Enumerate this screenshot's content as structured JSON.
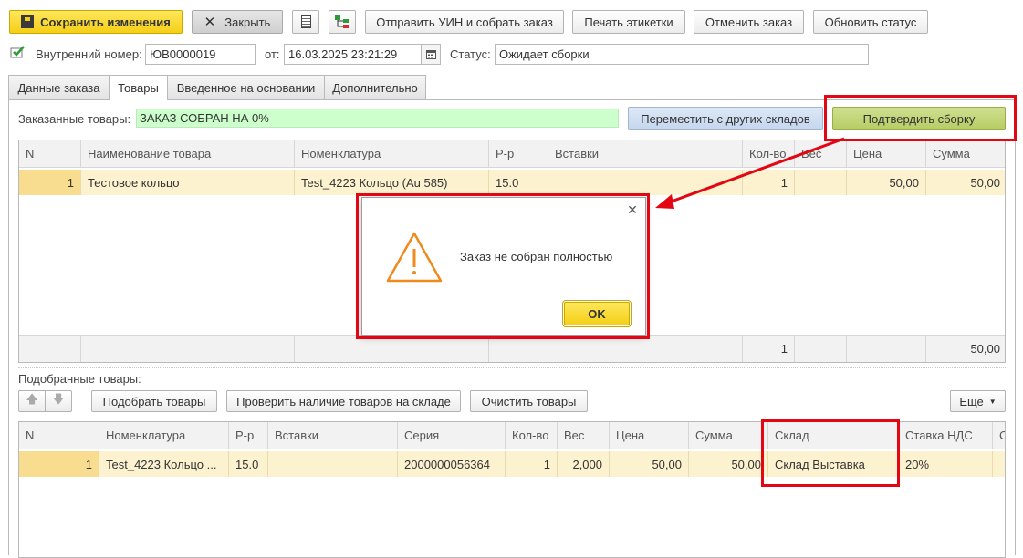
{
  "toolbar": {
    "save_label": "Сохранить изменения",
    "close_label": "Закрыть",
    "send_uin_label": "Отправить УИН и собрать заказ",
    "print_labels_label": "Печать этикетки",
    "cancel_order_label": "Отменить заказ",
    "refresh_status_label": "Обновить статус"
  },
  "header": {
    "internal_number_label": "Внутренний номер:",
    "internal_number_value": "ЮВ0000019",
    "from_label": "от:",
    "date_value": "16.03.2025 23:21:29",
    "status_label": "Статус:",
    "status_value": "Ожидает сборки"
  },
  "tabs": [
    {
      "label": "Данные заказа",
      "active": false
    },
    {
      "label": "Товары",
      "active": true
    },
    {
      "label": "Введенное на основании",
      "active": false
    },
    {
      "label": "Дополнительно",
      "active": false
    }
  ],
  "ordered": {
    "label": "Заказанные товары:",
    "progress_text": "ЗАКАЗ СОБРАН НА 0%",
    "move_button": "Переместить с других складов",
    "confirm_button": "Подтвердить сборку",
    "columns": [
      "N",
      "Наименование товара",
      "Номенклатура",
      "Р-р",
      "Вставки",
      "Кол-во",
      "Вес",
      "Цена",
      "Сумма"
    ],
    "row": {
      "n": "1",
      "name": "Тестовое кольцо",
      "nomenclature": "Test_4223 Кольцо (Au 585)",
      "size": "15.0",
      "inserts": "",
      "qty": "1",
      "weight": "",
      "price": "50,00",
      "sum": "50,00"
    },
    "footer": {
      "qty": "1",
      "sum": "50,00"
    }
  },
  "dialog": {
    "message": "Заказ не собран полностью",
    "ok_label": "OK",
    "icon": "warning-icon"
  },
  "picked": {
    "label": "Подобранные товары:",
    "pick_button": "Подобрать товары",
    "check_button": "Проверить наличие товаров на складе",
    "clear_button": "Очистить товары",
    "more_button": "Еще",
    "columns": [
      "N",
      "Номенклатура",
      "Р-р",
      "Вставки",
      "Серия",
      "Кол-во",
      "Вес",
      "Цена",
      "Сумма",
      "Склад",
      "Ставка НДС",
      "С"
    ],
    "row": {
      "n": "1",
      "nomenclature": "Test_4223 Кольцо ...",
      "size": "15.0",
      "inserts": "",
      "series": "2000000056364",
      "qty": "1",
      "weight": "2,000",
      "price": "50,00",
      "sum": "50,00",
      "warehouse": "Склад Выставка",
      "vat": "20%",
      "extra": ""
    }
  },
  "colors": {
    "accent_yellow": "#f5cf17",
    "highlight_red": "#e30613",
    "progress_green": "#ccffcc",
    "row_yellow": "#fcf2cf"
  }
}
